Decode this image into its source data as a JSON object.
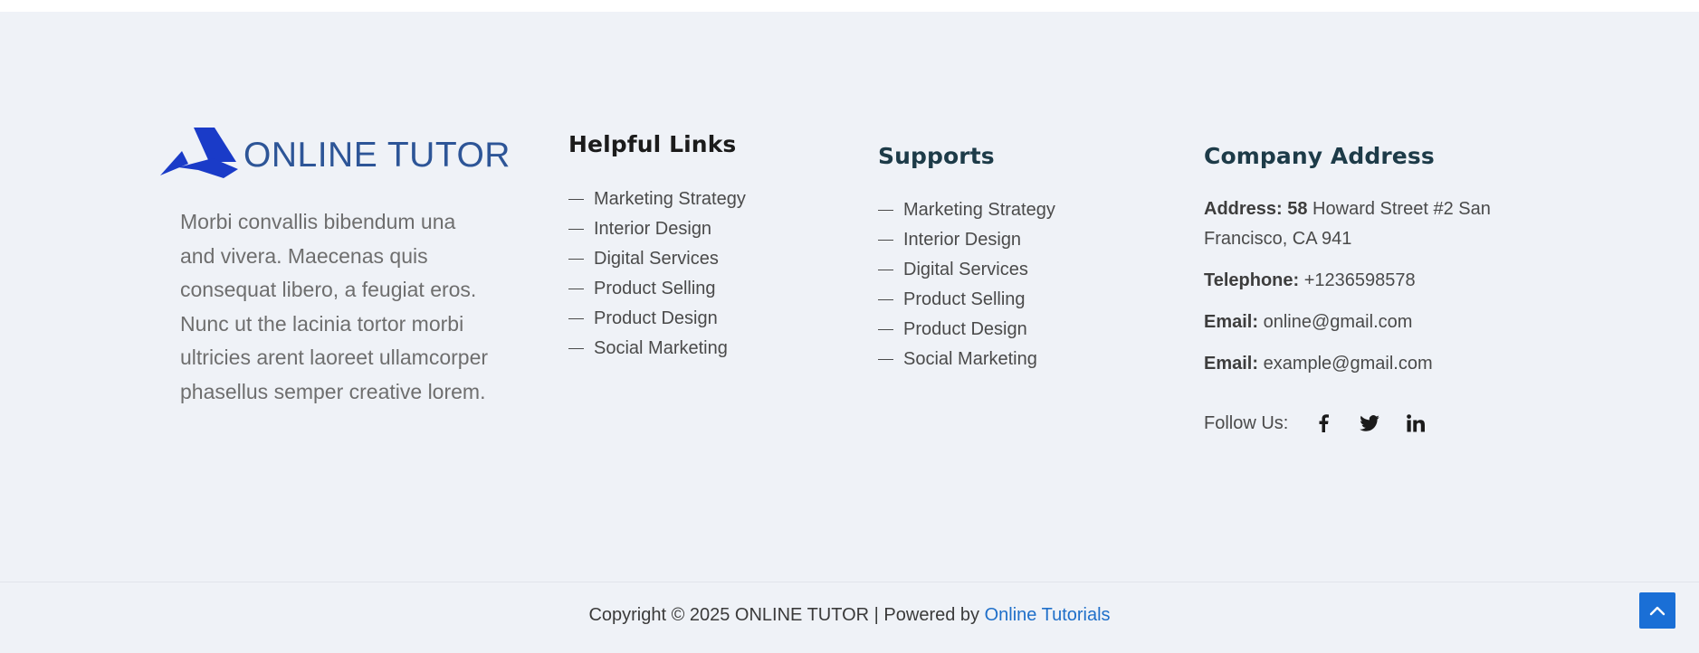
{
  "brand": {
    "logo_text": "ONLINE TUTOR",
    "about": "Morbi convallis bibendum una and vivera. Maecenas quis consequat libero, a feugiat eros. Nunc ut the lacinia tortor morbi ultricies arent laoreet ullamcorper phasellus semper creative lorem."
  },
  "helpful_links": {
    "title": "Helpful Links",
    "items": [
      {
        "label": "Marketing Strategy"
      },
      {
        "label": "Interior Design"
      },
      {
        "label": "Digital Services"
      },
      {
        "label": "Product Selling"
      },
      {
        "label": "Product Design"
      },
      {
        "label": "Social Marketing"
      }
    ]
  },
  "supports": {
    "title": "Supports",
    "items": [
      {
        "label": "Marketing Strategy"
      },
      {
        "label": "Interior Design"
      },
      {
        "label": "Digital Services"
      },
      {
        "label": "Product Selling"
      },
      {
        "label": "Product Design"
      },
      {
        "label": "Social Marketing"
      }
    ]
  },
  "company_address": {
    "title": "Company Address",
    "address_label": "Address: 58",
    "address_value": " Howard Street #2 San Francisco, CA 941",
    "telephone_label": "Telephone:",
    "telephone_value": " +1236598578",
    "email1_label": "Email:",
    "email1_value": " online@gmail.com",
    "email2_label": "Email:",
    "email2_value": " example@gmail.com",
    "follow_label": "Follow Us:",
    "social": [
      {
        "icon": "facebook-icon"
      },
      {
        "icon": "twitter-icon"
      },
      {
        "icon": "linkedin-icon"
      }
    ]
  },
  "bottom_bar": {
    "copyright_text": "Copyright © 2025 ONLINE TUTOR | Powered by ",
    "powered_link": "Online Tutorials",
    "scroll_top_icon": "chevron-up-icon"
  },
  "colors": {
    "background": "#eff2f7",
    "brand_blue": "#2d5597",
    "logo_mark": "#1a3bc8",
    "link_blue": "#1f6fc9",
    "scroll_button": "#1a6fd6",
    "heading_dark": "#1d3b48"
  }
}
